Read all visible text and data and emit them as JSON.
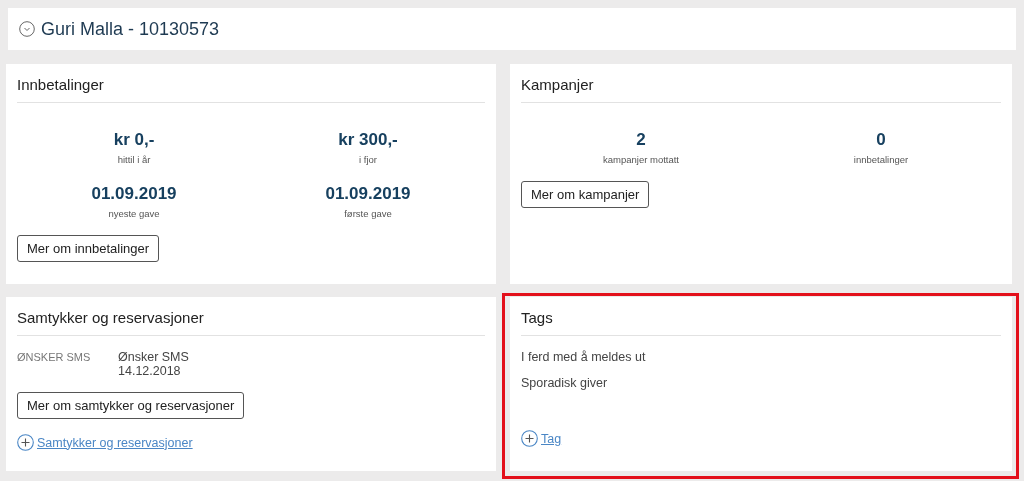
{
  "header": {
    "title": "Guri Malla - 10130573"
  },
  "cards": [
    {
      "kind": "stats",
      "title": "Innbetalinger",
      "highlighted": false,
      "stats": [
        {
          "value": "kr 0,-",
          "label": "hittil i år"
        },
        {
          "value": "kr 300,-",
          "label": "i fjor"
        },
        {
          "value": "01.09.2019",
          "label": "nyeste gave"
        },
        {
          "value": "01.09.2019",
          "label": "første gave"
        }
      ],
      "button": "Mer om innbetalinger"
    },
    {
      "kind": "stats",
      "title": "Kampanjer",
      "highlighted": false,
      "stats": [
        {
          "value": "2",
          "label": "kampanjer mottatt"
        },
        {
          "value": "0",
          "label": "innbetalinger"
        }
      ],
      "button": "Mer om kampanjer"
    },
    {
      "kind": "consents",
      "title": "Samtykker og reservasjoner",
      "highlighted": false,
      "rows": [
        {
          "label": "ØNSKER SMS",
          "value": "Ønsker SMS",
          "date": "14.12.2018"
        }
      ],
      "button": "Mer om samtykker og reservasjoner",
      "add_link": "Samtykker og reservasjoner"
    },
    {
      "kind": "tags",
      "title": "Tags",
      "highlighted": true,
      "tags": [
        "I ferd med å meldes ut",
        "Sporadisk giver"
      ],
      "add_link": "Tag"
    }
  ]
}
